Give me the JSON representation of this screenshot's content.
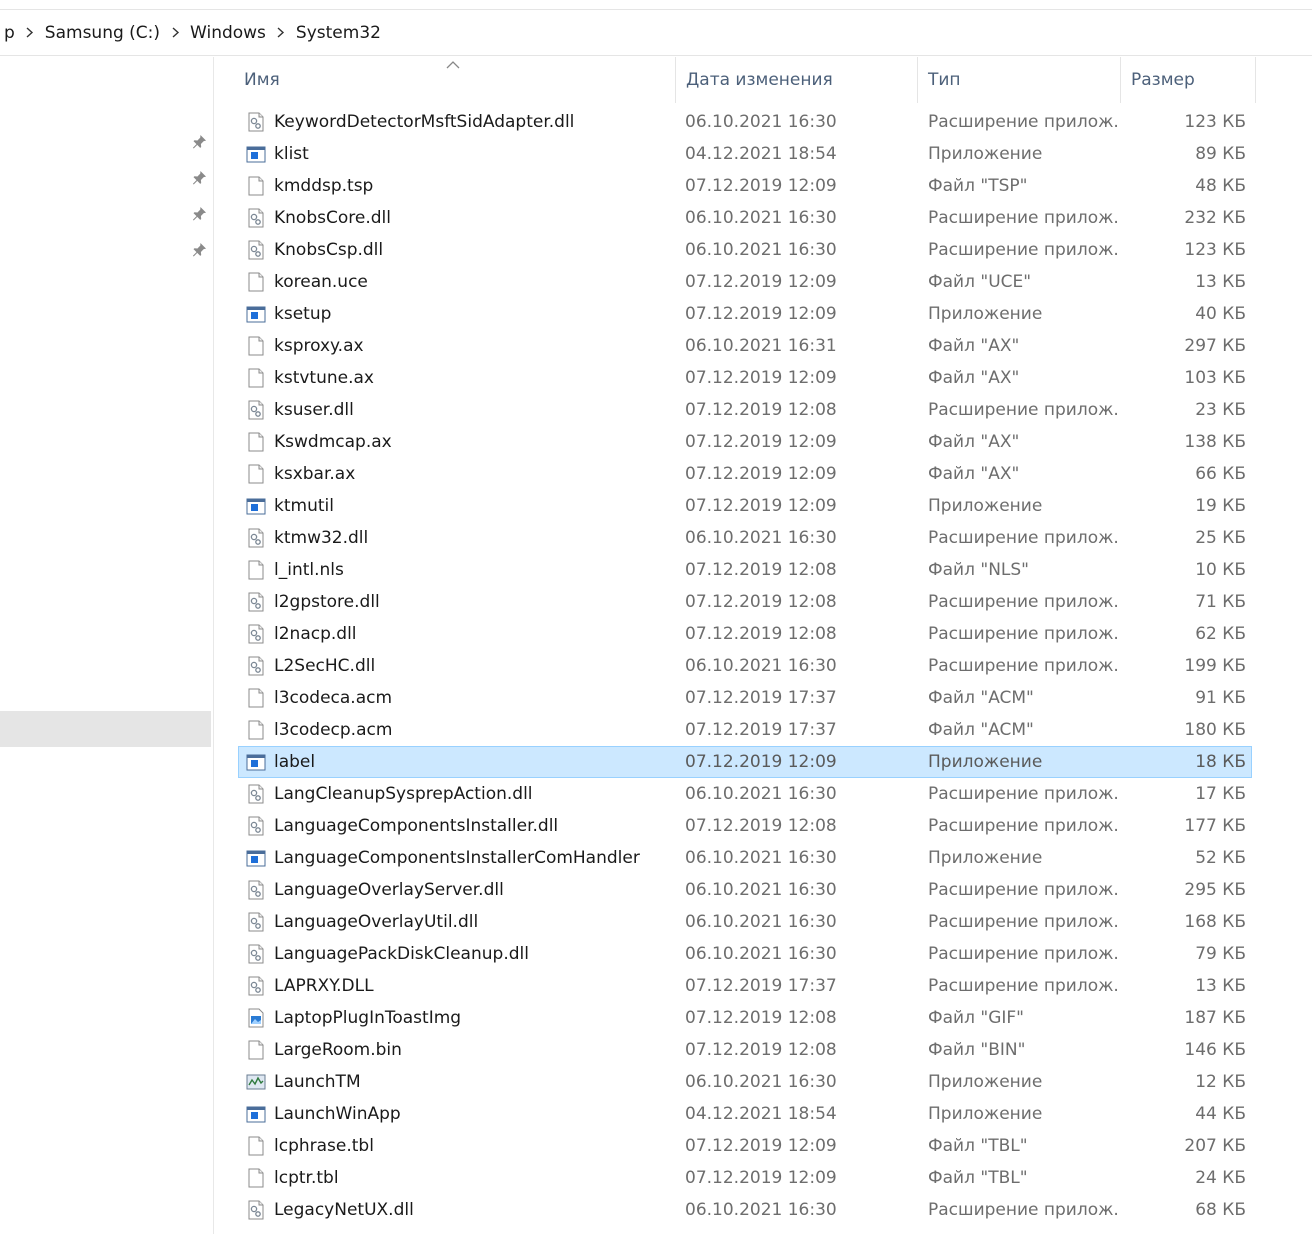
{
  "breadcrumb": [
    "p",
    "Samsung (C:)",
    "Windows",
    "System32"
  ],
  "columns": {
    "name": "Имя",
    "date": "Дата изменения",
    "type": "Тип",
    "size": "Размер"
  },
  "colors": {
    "selected_row": "#cce8ff",
    "selected_border": "#99d1ff",
    "header_text": "#4c607a",
    "muted_text": "#6d6d6d"
  },
  "files": [
    {
      "name": "KeywordDetectorMsftSidAdapter.dll",
      "date": "06.10.2021 16:30",
      "type": "Расширение прилож...",
      "size": "123 КБ",
      "icon": "dll-icon"
    },
    {
      "name": "klist",
      "date": "04.12.2021 18:54",
      "type": "Приложение",
      "size": "89 КБ",
      "icon": "app-icon"
    },
    {
      "name": "kmddsp.tsp",
      "date": "07.12.2019 12:09",
      "type": "Файл \"TSP\"",
      "size": "48 КБ",
      "icon": "file-icon"
    },
    {
      "name": "KnobsCore.dll",
      "date": "06.10.2021 16:30",
      "type": "Расширение прилож...",
      "size": "232 КБ",
      "icon": "dll-icon"
    },
    {
      "name": "KnobsCsp.dll",
      "date": "06.10.2021 16:30",
      "type": "Расширение прилож...",
      "size": "123 КБ",
      "icon": "dll-icon"
    },
    {
      "name": "korean.uce",
      "date": "07.12.2019 12:09",
      "type": "Файл \"UCE\"",
      "size": "13 КБ",
      "icon": "file-icon"
    },
    {
      "name": "ksetup",
      "date": "07.12.2019 12:09",
      "type": "Приложение",
      "size": "40 КБ",
      "icon": "app-icon"
    },
    {
      "name": "ksproxy.ax",
      "date": "06.10.2021 16:31",
      "type": "Файл \"AX\"",
      "size": "297 КБ",
      "icon": "file-icon"
    },
    {
      "name": "kstvtune.ax",
      "date": "07.12.2019 12:09",
      "type": "Файл \"AX\"",
      "size": "103 КБ",
      "icon": "file-icon"
    },
    {
      "name": "ksuser.dll",
      "date": "07.12.2019 12:08",
      "type": "Расширение прилож...",
      "size": "23 КБ",
      "icon": "dll-icon"
    },
    {
      "name": "Kswdmcap.ax",
      "date": "07.12.2019 12:09",
      "type": "Файл \"AX\"",
      "size": "138 КБ",
      "icon": "file-icon"
    },
    {
      "name": "ksxbar.ax",
      "date": "07.12.2019 12:09",
      "type": "Файл \"AX\"",
      "size": "66 КБ",
      "icon": "file-icon"
    },
    {
      "name": "ktmutil",
      "date": "07.12.2019 12:09",
      "type": "Приложение",
      "size": "19 КБ",
      "icon": "app-icon"
    },
    {
      "name": "ktmw32.dll",
      "date": "06.10.2021 16:30",
      "type": "Расширение прилож...",
      "size": "25 КБ",
      "icon": "dll-icon"
    },
    {
      "name": "l_intl.nls",
      "date": "07.12.2019 12:08",
      "type": "Файл \"NLS\"",
      "size": "10 КБ",
      "icon": "file-icon"
    },
    {
      "name": "l2gpstore.dll",
      "date": "07.12.2019 12:08",
      "type": "Расширение прилож...",
      "size": "71 КБ",
      "icon": "dll-icon"
    },
    {
      "name": "l2nacp.dll",
      "date": "07.12.2019 12:08",
      "type": "Расширение прилож...",
      "size": "62 КБ",
      "icon": "dll-icon"
    },
    {
      "name": "L2SecHC.dll",
      "date": "06.10.2021 16:30",
      "type": "Расширение прилож...",
      "size": "199 КБ",
      "icon": "dll-icon"
    },
    {
      "name": "l3codeca.acm",
      "date": "07.12.2019 17:37",
      "type": "Файл \"ACM\"",
      "size": "91 КБ",
      "icon": "file-icon"
    },
    {
      "name": "l3codecp.acm",
      "date": "07.12.2019 17:37",
      "type": "Файл \"ACM\"",
      "size": "180 КБ",
      "icon": "file-icon"
    },
    {
      "name": "label",
      "date": "07.12.2019 12:09",
      "type": "Приложение",
      "size": "18 КБ",
      "icon": "app-icon",
      "selected": true
    },
    {
      "name": "LangCleanupSysprepAction.dll",
      "date": "06.10.2021 16:30",
      "type": "Расширение прилож...",
      "size": "17 КБ",
      "icon": "dll-icon"
    },
    {
      "name": "LanguageComponentsInstaller.dll",
      "date": "07.12.2019 12:08",
      "type": "Расширение прилож...",
      "size": "177 КБ",
      "icon": "dll-icon"
    },
    {
      "name": "LanguageComponentsInstallerComHandler",
      "date": "06.10.2021 16:30",
      "type": "Приложение",
      "size": "52 КБ",
      "icon": "app-icon"
    },
    {
      "name": "LanguageOverlayServer.dll",
      "date": "06.10.2021 16:30",
      "type": "Расширение прилож...",
      "size": "295 КБ",
      "icon": "dll-icon"
    },
    {
      "name": "LanguageOverlayUtil.dll",
      "date": "06.10.2021 16:30",
      "type": "Расширение прилож...",
      "size": "168 КБ",
      "icon": "dll-icon"
    },
    {
      "name": "LanguagePackDiskCleanup.dll",
      "date": "06.10.2021 16:30",
      "type": "Расширение прилож...",
      "size": "79 КБ",
      "icon": "dll-icon"
    },
    {
      "name": "LAPRXY.DLL",
      "date": "07.12.2019 17:37",
      "type": "Расширение прилож...",
      "size": "13 КБ",
      "icon": "dll-icon"
    },
    {
      "name": "LaptopPlugInToastImg",
      "date": "07.12.2019 12:08",
      "type": "Файл \"GIF\"",
      "size": "187 КБ",
      "icon": "image-icon"
    },
    {
      "name": "LargeRoom.bin",
      "date": "07.12.2019 12:08",
      "type": "Файл \"BIN\"",
      "size": "146 КБ",
      "icon": "file-icon"
    },
    {
      "name": "LaunchTM",
      "date": "06.10.2021 16:30",
      "type": "Приложение",
      "size": "12 КБ",
      "icon": "taskmanager-icon"
    },
    {
      "name": "LaunchWinApp",
      "date": "04.12.2021 18:54",
      "type": "Приложение",
      "size": "44 КБ",
      "icon": "app-icon"
    },
    {
      "name": "lcphrase.tbl",
      "date": "07.12.2019 12:09",
      "type": "Файл \"TBL\"",
      "size": "207 КБ",
      "icon": "file-icon"
    },
    {
      "name": "lcptr.tbl",
      "date": "07.12.2019 12:09",
      "type": "Файл \"TBL\"",
      "size": "24 КБ",
      "icon": "file-icon"
    },
    {
      "name": "LegacyNetUX.dll",
      "date": "06.10.2021 16:30",
      "type": "Расширение прилож...",
      "size": "68 КБ",
      "icon": "dll-icon"
    }
  ]
}
